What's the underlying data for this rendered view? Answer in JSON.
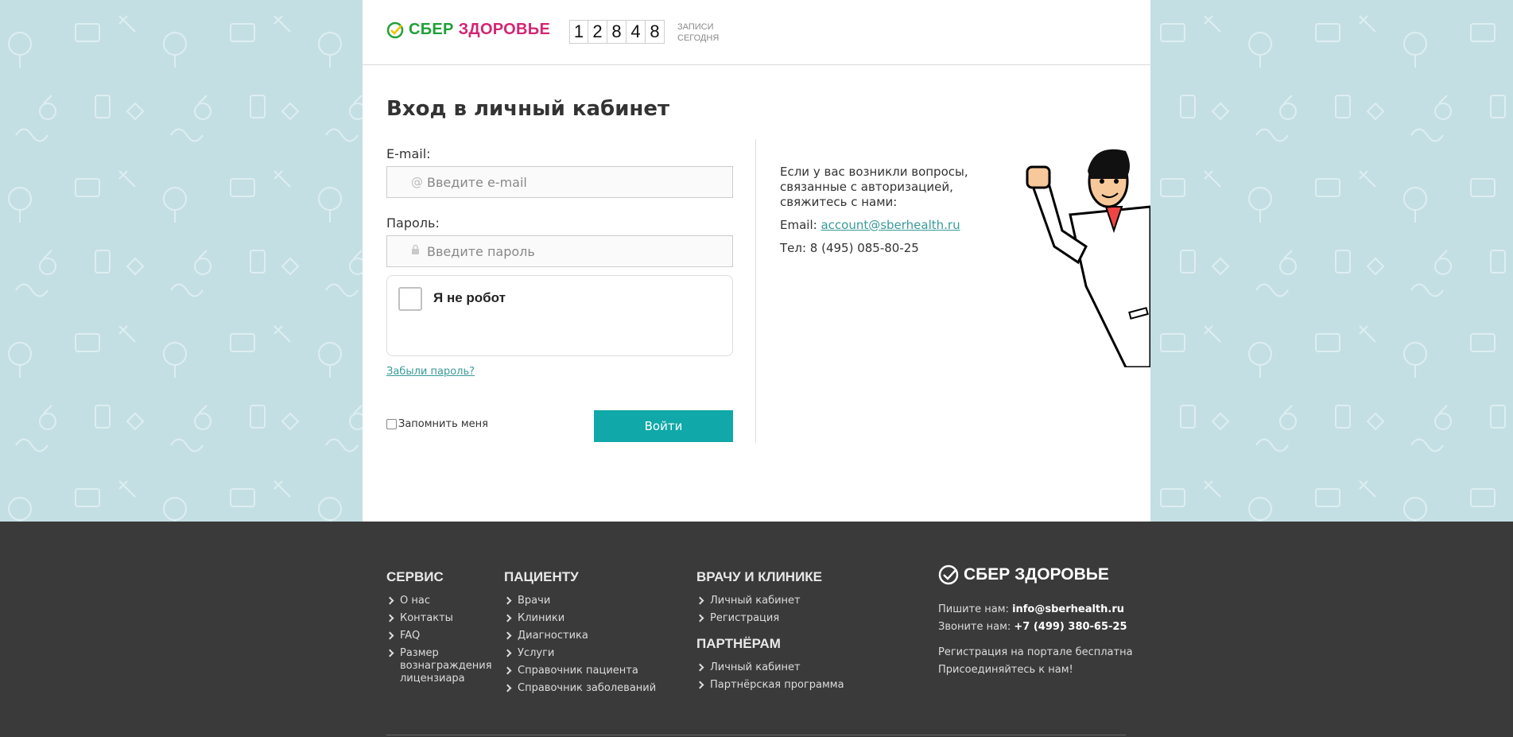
{
  "header": {
    "logo_sber": "СБЕР",
    "logo_zdr": "ЗДОРОВЬЕ",
    "counter_digits": [
      "1",
      "2",
      "8",
      "4",
      "8"
    ],
    "counter_label_1": "ЗАПИСИ",
    "counter_label_2": "СЕГОДНЯ"
  },
  "login": {
    "title": "Вход в личный кабинет",
    "email_label": "E-mail:",
    "email_placeholder": "Введите e-mail",
    "password_label": "Пароль:",
    "password_placeholder": "Введите пароль",
    "captcha_label": "Я не робот",
    "forgot_link": "Забыли пароль?",
    "remember_label": "Запомнить меня",
    "submit_label": "Войти"
  },
  "help": {
    "text": "Если у вас возникли вопросы, связанные с авторизацией, свяжитесь с нами:",
    "email_prefix": "Email: ",
    "email": "account@sberhealth.ru",
    "phone": "Тел: 8 (495) 085-80-25"
  },
  "footer": {
    "service": {
      "title": "СЕРВИС",
      "items": [
        "О нас",
        "Контакты",
        "FAQ",
        "Размер вознаграждения лицензиара"
      ]
    },
    "patient": {
      "title": "ПАЦИЕНТУ",
      "items": [
        "Врачи",
        "Клиники",
        "Диагностика",
        "Услуги",
        "Справочник пациента",
        "Справочник заболеваний"
      ]
    },
    "doctor": {
      "title": "ВРАЧУ И КЛИНИКЕ",
      "items": [
        "Личный кабинет",
        "Регистрация"
      ]
    },
    "partners": {
      "title": "ПАРТНЁРАМ",
      "items": [
        "Личный кабинет",
        "Партнёрская программа"
      ]
    },
    "brand": "СБЕР ЗДОРОВЬЕ",
    "write_prefix": "Пишите нам: ",
    "write_email": "info@sberhealth.ru",
    "call_prefix": "Звоните нам: ",
    "call_phone": "+7 (499) 380-65-25",
    "reg_free": "Регистрация на портале бесплатна",
    "join": "Присоединяйтесь к нам!"
  },
  "colors": {
    "accent": "#10a8a8",
    "brand_green": "#21a038",
    "brand_pink": "#d22674",
    "footer_bg": "#3a3a3a",
    "page_bg": "#c4dfe4"
  }
}
